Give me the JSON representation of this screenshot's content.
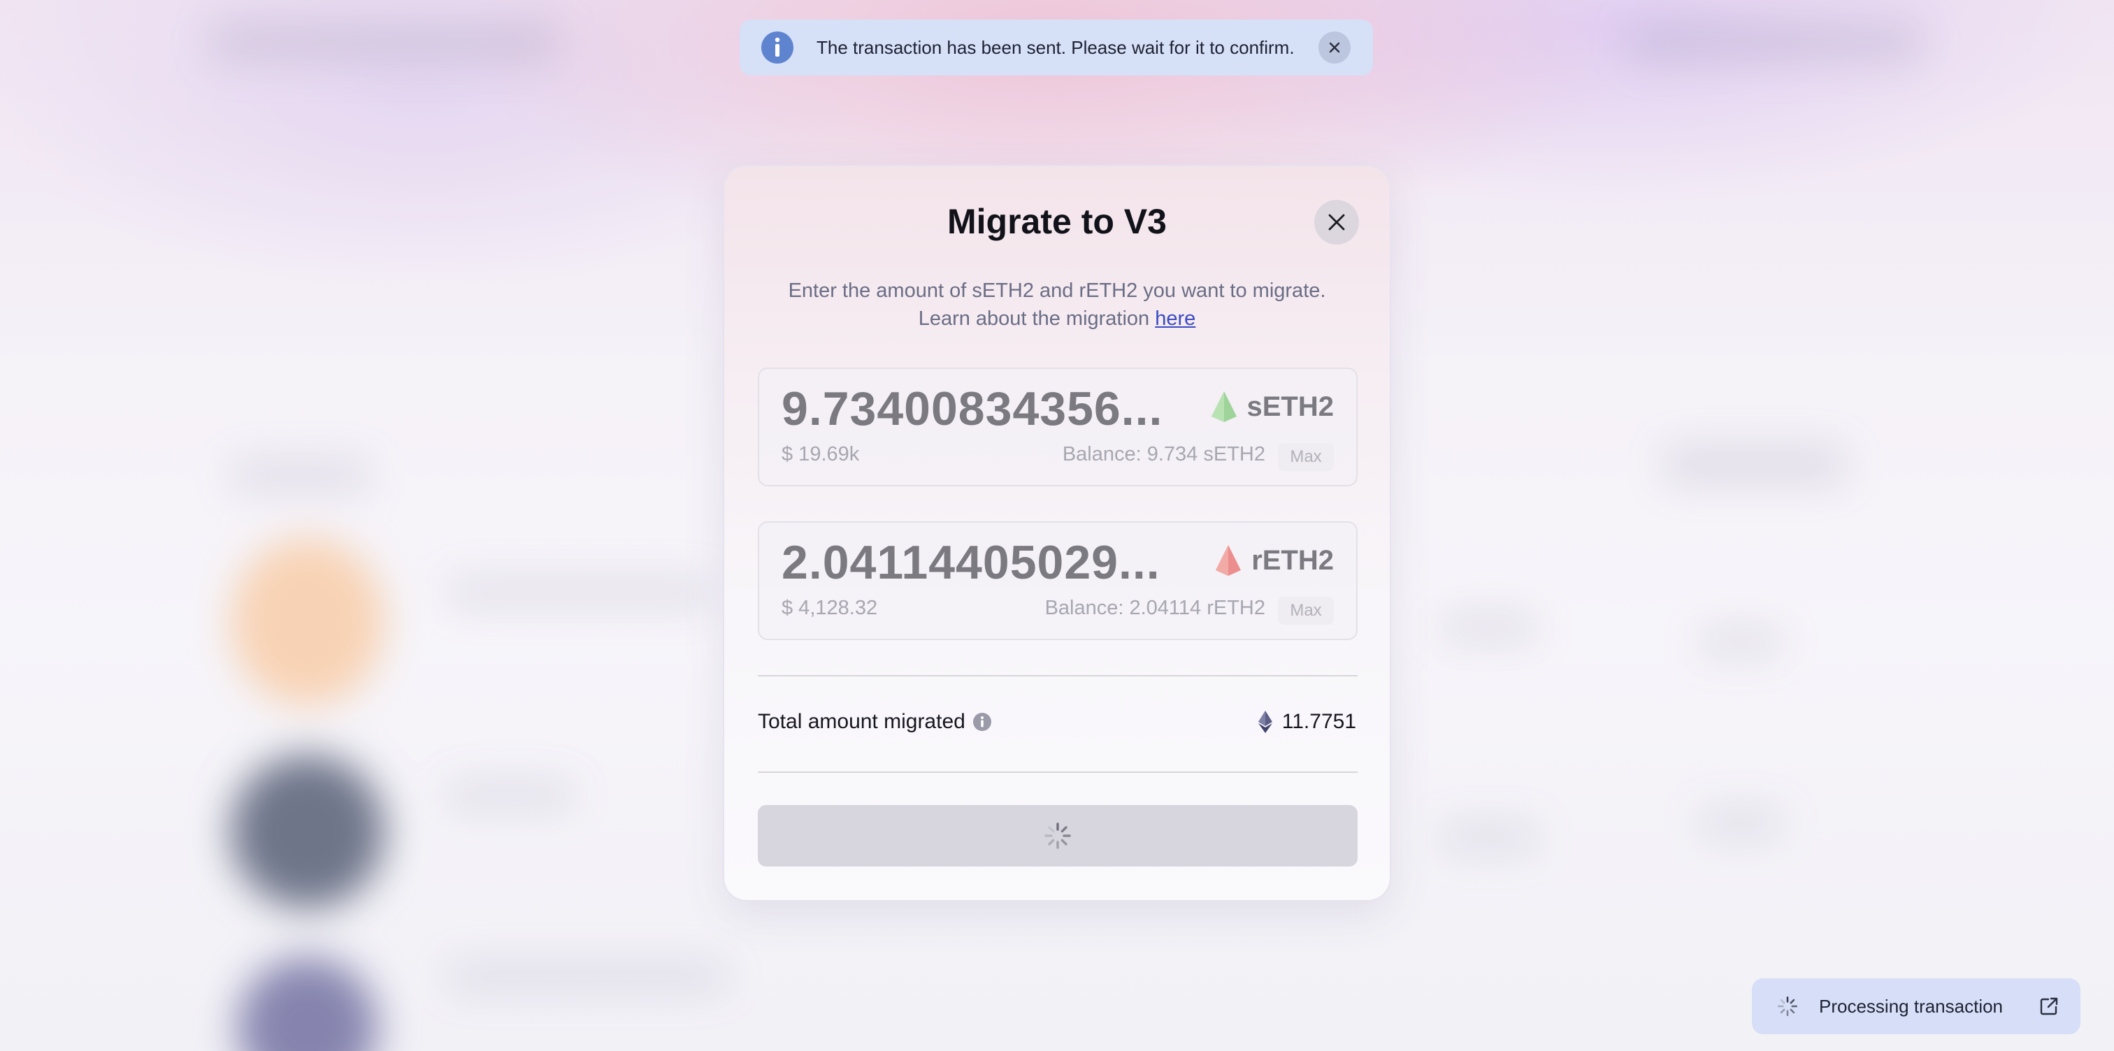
{
  "toast": {
    "message": "The transaction has been sent. Please wait for it to confirm.",
    "icon": "info-icon",
    "close_icon": "close-icon"
  },
  "modal": {
    "title": "Migrate to V3",
    "description_line1": "Enter the amount of sETH2 and rETH2 you want to migrate.",
    "description_line2_prefix": "Learn about the migration",
    "description_link": "here",
    "tokens": [
      {
        "amount": "9.73400834356...",
        "symbol": "sETH2",
        "usd": "$ 19.69k",
        "balance": "Balance: 9.734 sETH2",
        "max_label": "Max",
        "icon_color": "#8fd18a"
      },
      {
        "amount": "2.04114405029...",
        "symbol": "rETH2",
        "usd": "$ 4,128.32",
        "balance": "Balance: 2.04114 rETH2",
        "max_label": "Max",
        "icon_color": "#ee8c8c"
      }
    ],
    "total_label": "Total amount migrated",
    "total_value": "11.7751",
    "submit_state": "loading"
  },
  "processing": {
    "label": "Processing transaction",
    "icon": "external-link-icon"
  },
  "colors": {
    "toast_bg": "#d6e0f7",
    "link": "#3b4ac4",
    "button_disabled": "#d7d6de"
  }
}
